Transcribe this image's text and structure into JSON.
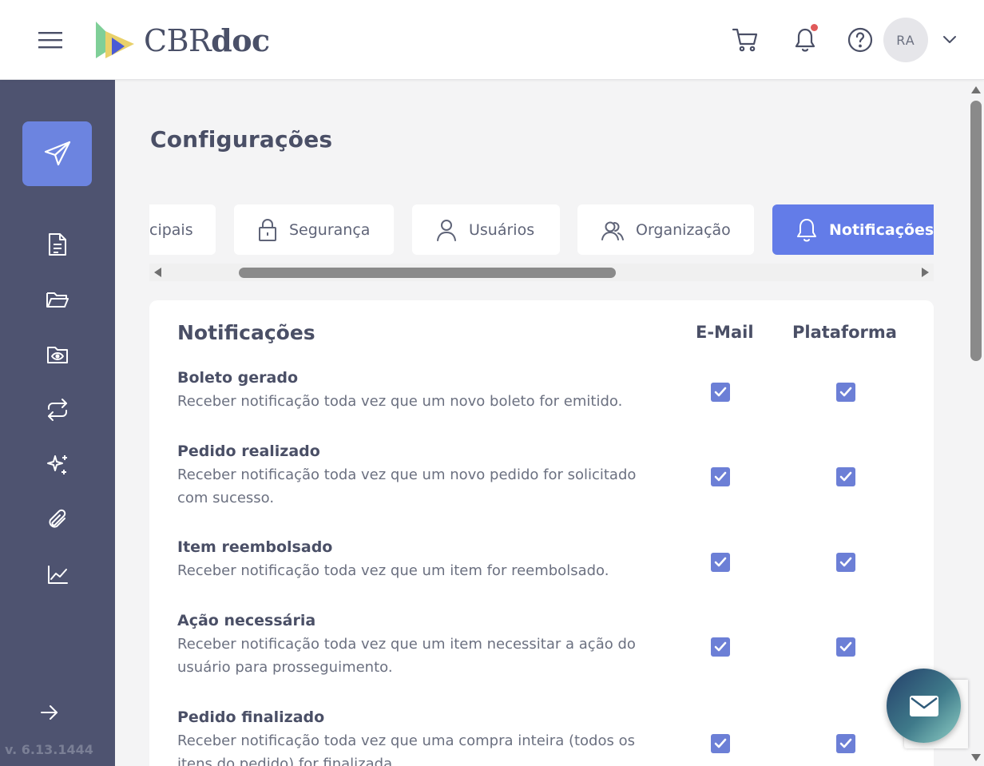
{
  "app": {
    "logo_prefix": "CBR",
    "logo_suffix": "doc",
    "avatar_initials": "RA",
    "version": "v. 6.13.1444"
  },
  "colors": {
    "sidebar": "#4e5370",
    "accent": "#637ce8",
    "checkbox": "#6c7fd6",
    "notification_dot": "#e05a5a"
  },
  "header": {
    "icons": [
      "menu-icon",
      "cart-icon",
      "bell-icon",
      "help-icon",
      "chevron-down-icon"
    ]
  },
  "sidebar": {
    "items": [
      "send-icon",
      "document-icon",
      "folder-open-icon",
      "folder-eye-icon",
      "repeat-icon",
      "sparkles-icon",
      "paperclip-icon",
      "chart-line-icon",
      "arrow-right-icon"
    ]
  },
  "page": {
    "title": "Configurações"
  },
  "tabs": [
    {
      "label": "cipais",
      "icon": ""
    },
    {
      "label": "Segurança",
      "icon": "lock-icon"
    },
    {
      "label": "Usuários",
      "icon": "user-icon"
    },
    {
      "label": "Organização",
      "icon": "users-icon"
    },
    {
      "label": "Notificações",
      "icon": "bell-icon",
      "active": true
    }
  ],
  "notifications": {
    "title": "Notificações",
    "col_email": "E-Mail",
    "col_platform": "Plataforma",
    "rows": [
      {
        "title": "Boleto gerado",
        "desc": "Receber notificação toda vez que um novo boleto for emitido.",
        "email": true,
        "platform": true
      },
      {
        "title": "Pedido realizado",
        "desc": "Receber notificação toda vez que um novo pedido for solicitado com sucesso.",
        "email": true,
        "platform": true
      },
      {
        "title": "Item reembolsado",
        "desc": "Receber notificação toda vez que um item for reembolsado.",
        "email": true,
        "platform": true
      },
      {
        "title": "Ação necessária",
        "desc": "Receber notificação toda vez que um item necessitar a ação do usuário para prosseguimento.",
        "email": true,
        "platform": true
      },
      {
        "title": "Pedido finalizado",
        "desc": "Receber notificação toda vez que uma compra inteira (todos os itens do pedido) for finalizada.",
        "email": true,
        "platform": true
      }
    ]
  }
}
